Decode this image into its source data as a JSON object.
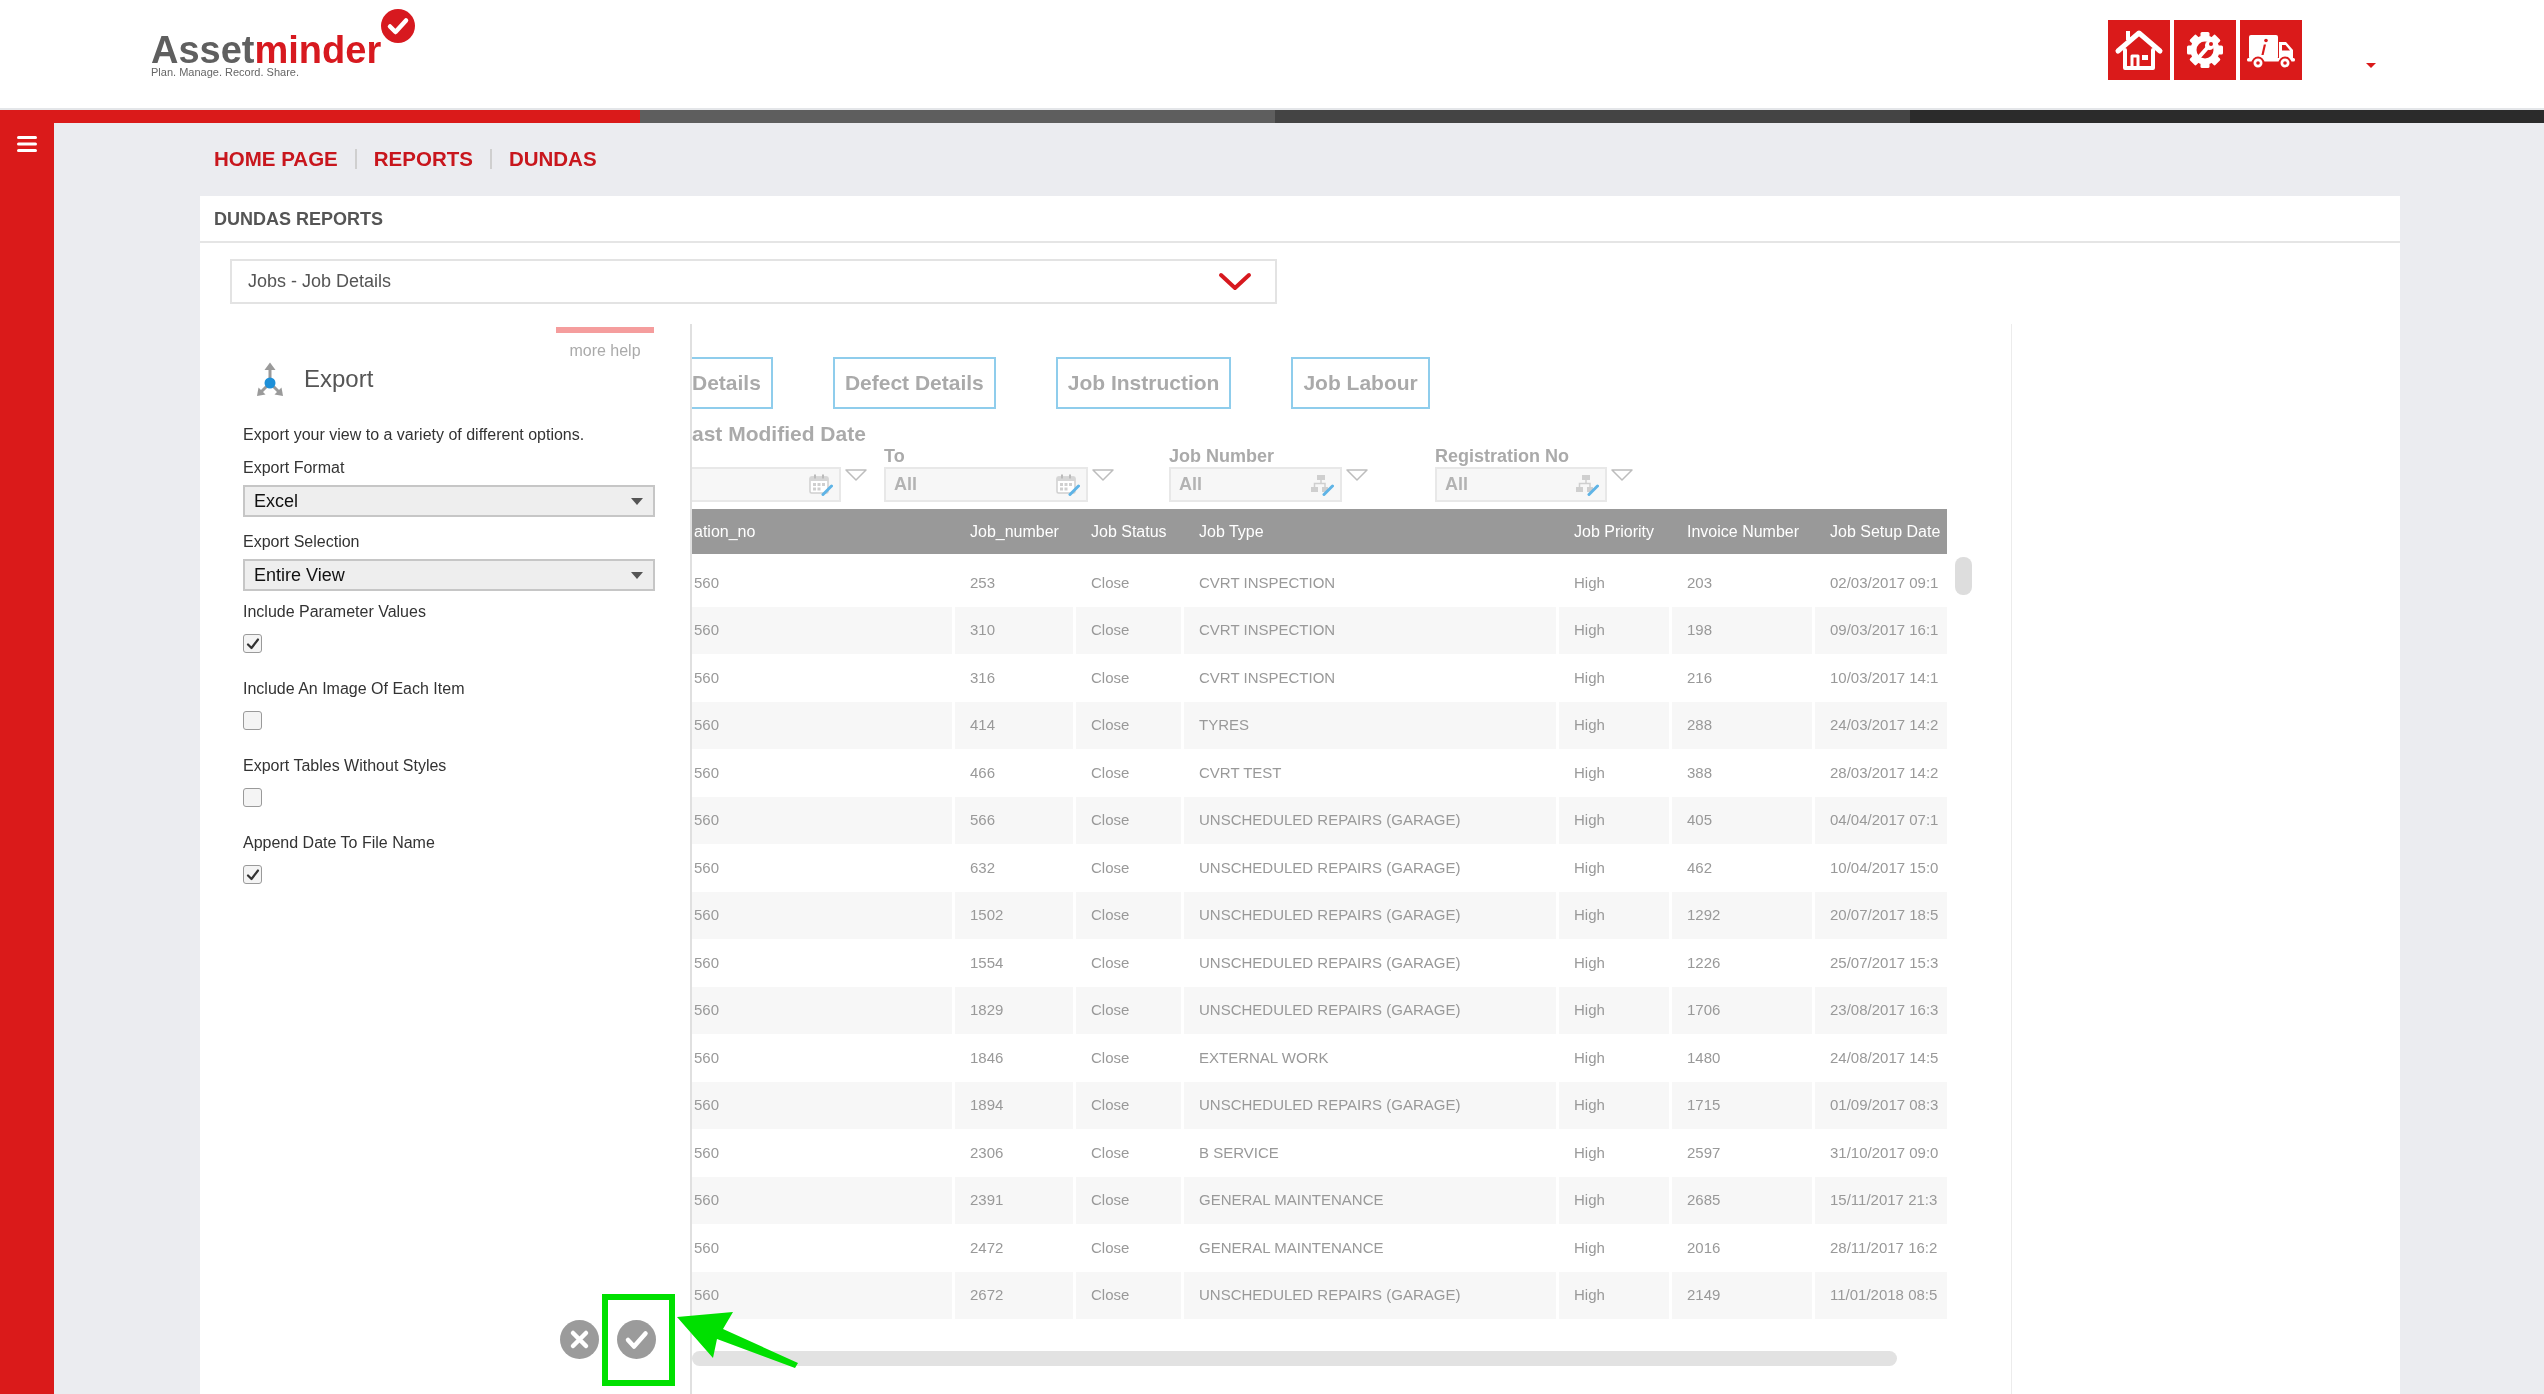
{
  "header": {
    "logo": {
      "wordmark": [
        {
          "text": "Asset",
          "kind": "dark"
        },
        {
          "text": "minder",
          "kind": "accent"
        }
      ],
      "tagline": "Plan. Manage. Record. Share."
    }
  },
  "breadcrumb": [
    "HOME PAGE",
    "REPORTS",
    "DUNDAS"
  ],
  "card": {
    "title": "DUNDAS REPORTS",
    "report_select": {
      "value": "Jobs - Job Details"
    }
  },
  "export_panel": {
    "help_link": "more help",
    "title": "Export",
    "description": "Export your view to a variety of different options.",
    "fields": [
      {
        "kind": "select",
        "label": "Export Format",
        "value": "Excel"
      },
      {
        "kind": "select",
        "label": "Export Selection",
        "value": "Entire View"
      },
      {
        "kind": "checkbox",
        "label": "Include Parameter Values",
        "checked": true
      },
      {
        "kind": "checkbox",
        "label": "Include An Image Of Each Item",
        "checked": false
      },
      {
        "kind": "checkbox",
        "label": "Export Tables Without Styles",
        "checked": false
      },
      {
        "kind": "checkbox",
        "label": "Append Date To File Name",
        "checked": true
      }
    ],
    "actions": [
      {
        "kind": "cancel",
        "highlighted": false
      },
      {
        "kind": "confirm",
        "highlighted": true
      }
    ]
  },
  "dashboard": {
    "tabs": [
      {
        "label": "Details",
        "selected": false
      },
      {
        "label": "Defect Details",
        "selected": false
      },
      {
        "label": "Job Instruction",
        "selected": false
      },
      {
        "label": "Job Labour",
        "selected": false
      }
    ],
    "filters": [
      {
        "heading": "ast Modified Date",
        "kind": "date"
      },
      {
        "label": "To",
        "value": "All",
        "kind": "date"
      },
      {
        "label": "Job Number",
        "value": "All",
        "kind": "list"
      },
      {
        "label": "Registration No",
        "value": "All",
        "kind": "list"
      }
    ],
    "table": {
      "columns": [
        "ation_no",
        "Job_number",
        "Job Status",
        "Job Type",
        "Job Priority",
        "Invoice Number",
        "Job Setup Date"
      ],
      "rows": [
        [
          "560",
          "253",
          "Close",
          "CVRT INSPECTION",
          "High",
          "203",
          "02/03/2017 09:1"
        ],
        [
          "560",
          "310",
          "Close",
          "CVRT INSPECTION",
          "High",
          "198",
          "09/03/2017 16:1"
        ],
        [
          "560",
          "316",
          "Close",
          "CVRT INSPECTION",
          "High",
          "216",
          "10/03/2017 14:1"
        ],
        [
          "560",
          "414",
          "Close",
          "TYRES",
          "High",
          "288",
          "24/03/2017 14:2"
        ],
        [
          "560",
          "466",
          "Close",
          "CVRT TEST",
          "High",
          "388",
          "28/03/2017 14:2"
        ],
        [
          "560",
          "566",
          "Close",
          "UNSCHEDULED REPAIRS (GARAGE)",
          "High",
          "405",
          "04/04/2017 07:1"
        ],
        [
          "560",
          "632",
          "Close",
          "UNSCHEDULED REPAIRS (GARAGE)",
          "High",
          "462",
          "10/04/2017 15:0"
        ],
        [
          "560",
          "1502",
          "Close",
          "UNSCHEDULED REPAIRS (GARAGE)",
          "High",
          "1292",
          "20/07/2017 18:5"
        ],
        [
          "560",
          "1554",
          "Close",
          "UNSCHEDULED REPAIRS (GARAGE)",
          "High",
          "1226",
          "25/07/2017 15:3"
        ],
        [
          "560",
          "1829",
          "Close",
          "UNSCHEDULED REPAIRS (GARAGE)",
          "High",
          "1706",
          "23/08/2017 16:3"
        ],
        [
          "560",
          "1846",
          "Close",
          "EXTERNAL WORK",
          "High",
          "1480",
          "24/08/2017 14:5"
        ],
        [
          "560",
          "1894",
          "Close",
          "UNSCHEDULED REPAIRS (GARAGE)",
          "High",
          "1715",
          "01/09/2017 08:3"
        ],
        [
          "560",
          "2306",
          "Close",
          "B SERVICE",
          "High",
          "2597",
          "31/10/2017 09:0"
        ],
        [
          "560",
          "2391",
          "Close",
          "GENERAL MAINTENANCE",
          "High",
          "2685",
          "15/11/2017 21:3"
        ],
        [
          "560",
          "2472",
          "Close",
          "GENERAL MAINTENANCE",
          "High",
          "2016",
          "28/11/2017 16:2"
        ],
        [
          "560",
          "2672",
          "Close",
          "UNSCHEDULED REPAIRS (GARAGE)",
          "High",
          "2149",
          "11/01/2018 08:5"
        ]
      ]
    }
  }
}
